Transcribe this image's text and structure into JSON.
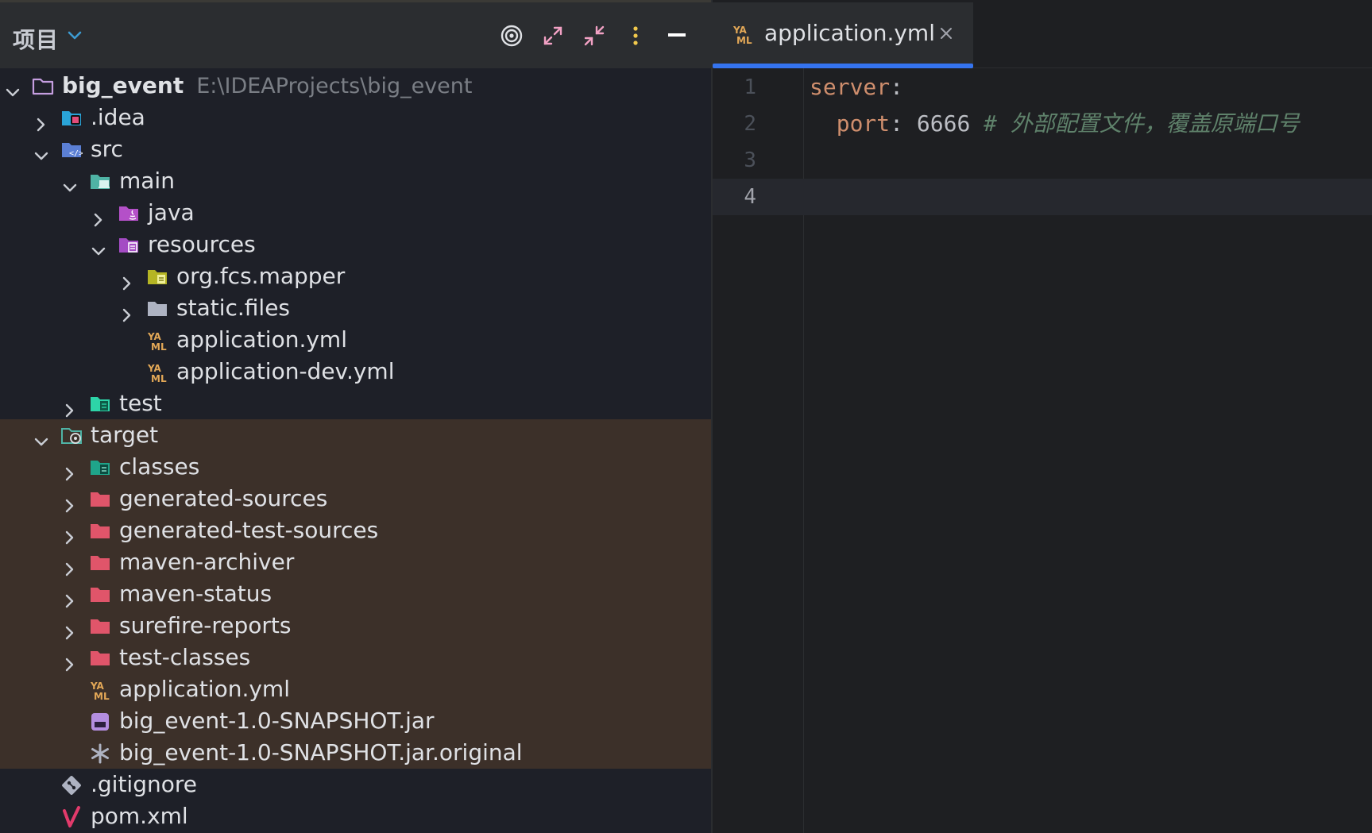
{
  "project_panel": {
    "title": "项目",
    "toolbar": {
      "locate_icon": "target-icon",
      "expand_icon": "expand-all-icon",
      "collapse_icon": "collapse-all-icon",
      "options_icon": "more-vertical-icon",
      "hide_icon": "minimize-icon"
    },
    "tree": [
      {
        "label": "big_event",
        "hint": "E:\\IDEAProjects\\big_event"
      },
      {
        "label": ".idea"
      },
      {
        "label": "src"
      },
      {
        "label": "main"
      },
      {
        "label": "java"
      },
      {
        "label": "resources"
      },
      {
        "label": "org.fcs.mapper"
      },
      {
        "label": "static.files"
      },
      {
        "label": "application.yml"
      },
      {
        "label": "application-dev.yml"
      },
      {
        "label": "test"
      },
      {
        "label": "target"
      },
      {
        "label": "classes"
      },
      {
        "label": "generated-sources"
      },
      {
        "label": "generated-test-sources"
      },
      {
        "label": "maven-archiver"
      },
      {
        "label": "maven-status"
      },
      {
        "label": "surefire-reports"
      },
      {
        "label": "test-classes"
      },
      {
        "label": "application.yml"
      },
      {
        "label": "big_event-1.0-SNAPSHOT.jar"
      },
      {
        "label": "big_event-1.0-SNAPSHOT.jar.original"
      },
      {
        "label": ".gitignore"
      },
      {
        "label": "pom.xml"
      }
    ]
  },
  "editor": {
    "tab": {
      "label": "application.yml",
      "icon": "yaml-icon",
      "close_icon": "close-icon"
    },
    "lines": [
      {
        "num": "1",
        "key": "server",
        "colon": ":"
      },
      {
        "num": "2",
        "indent": "  ",
        "key": "port",
        "colon": ":",
        "value": "6666",
        "comment": "# 外部配置文件，覆盖原端口号"
      },
      {
        "num": "3"
      },
      {
        "num": "4"
      }
    ]
  },
  "colors": {
    "accent": "#3574f0",
    "excluded_bg": "#3c3029",
    "yaml_key": "#cf8e6d",
    "comment": "#5f826b"
  }
}
